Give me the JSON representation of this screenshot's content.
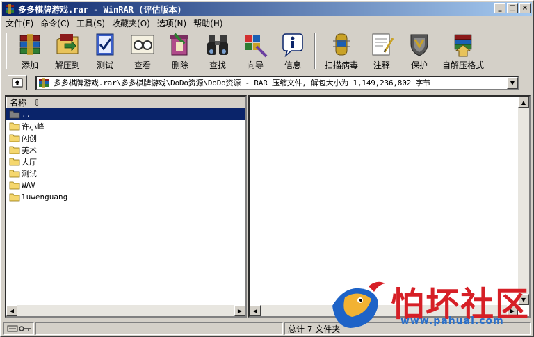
{
  "window": {
    "title": "多多棋牌游戏.rar - WinRAR (评估版本)",
    "buttons": {
      "minimize": "_",
      "maximize": "□",
      "close": "×"
    }
  },
  "menu": [
    {
      "label": "文件(F)"
    },
    {
      "label": "命令(C)"
    },
    {
      "label": "工具(S)"
    },
    {
      "label": "收藏夹(O)"
    },
    {
      "label": "选项(N)"
    },
    {
      "label": "帮助(H)"
    }
  ],
  "toolbar": [
    {
      "label": "添加",
      "icon": "add-archive-icon"
    },
    {
      "label": "解压到",
      "icon": "extract-to-icon"
    },
    {
      "label": "测试",
      "icon": "test-icon"
    },
    {
      "label": "查看",
      "icon": "view-icon"
    },
    {
      "label": "删除",
      "icon": "delete-icon"
    },
    {
      "label": "查找",
      "icon": "find-binoculars-icon"
    },
    {
      "label": "向导",
      "icon": "wizard-icon"
    },
    {
      "label": "信息",
      "icon": "info-icon"
    },
    {
      "label": "扫描病毒",
      "icon": "virus-scan-icon"
    },
    {
      "label": "注释",
      "icon": "comment-icon"
    },
    {
      "label": "保护",
      "icon": "protect-shield-icon"
    },
    {
      "label": "自解压格式",
      "icon": "sfx-icon"
    }
  ],
  "address": {
    "path": "多多棋牌游戏.rar\\多多棋牌游戏\\DoDo资源\\DoDo资源 - RAR 压缩文件, 解包大小为 1,149,236,802 字节"
  },
  "filelist": {
    "column_name": "名称",
    "sort_indicator": "⇩",
    "rows": [
      {
        "label": "..",
        "selected": true
      },
      {
        "label": "许小峰"
      },
      {
        "label": "闪创"
      },
      {
        "label": "美术"
      },
      {
        "label": "大厅"
      },
      {
        "label": "测试"
      },
      {
        "label": "WAV"
      },
      {
        "label": "luwenguang"
      }
    ]
  },
  "status": {
    "summary": "总计 7 文件夹"
  },
  "watermark": {
    "text": "怕坏社区",
    "url": "www.pahuai.com"
  },
  "colors": {
    "titlebar": "#0a246a",
    "selection": "#0a246a",
    "face": "#d4d0c8",
    "watermark_red": "#d61f26"
  }
}
